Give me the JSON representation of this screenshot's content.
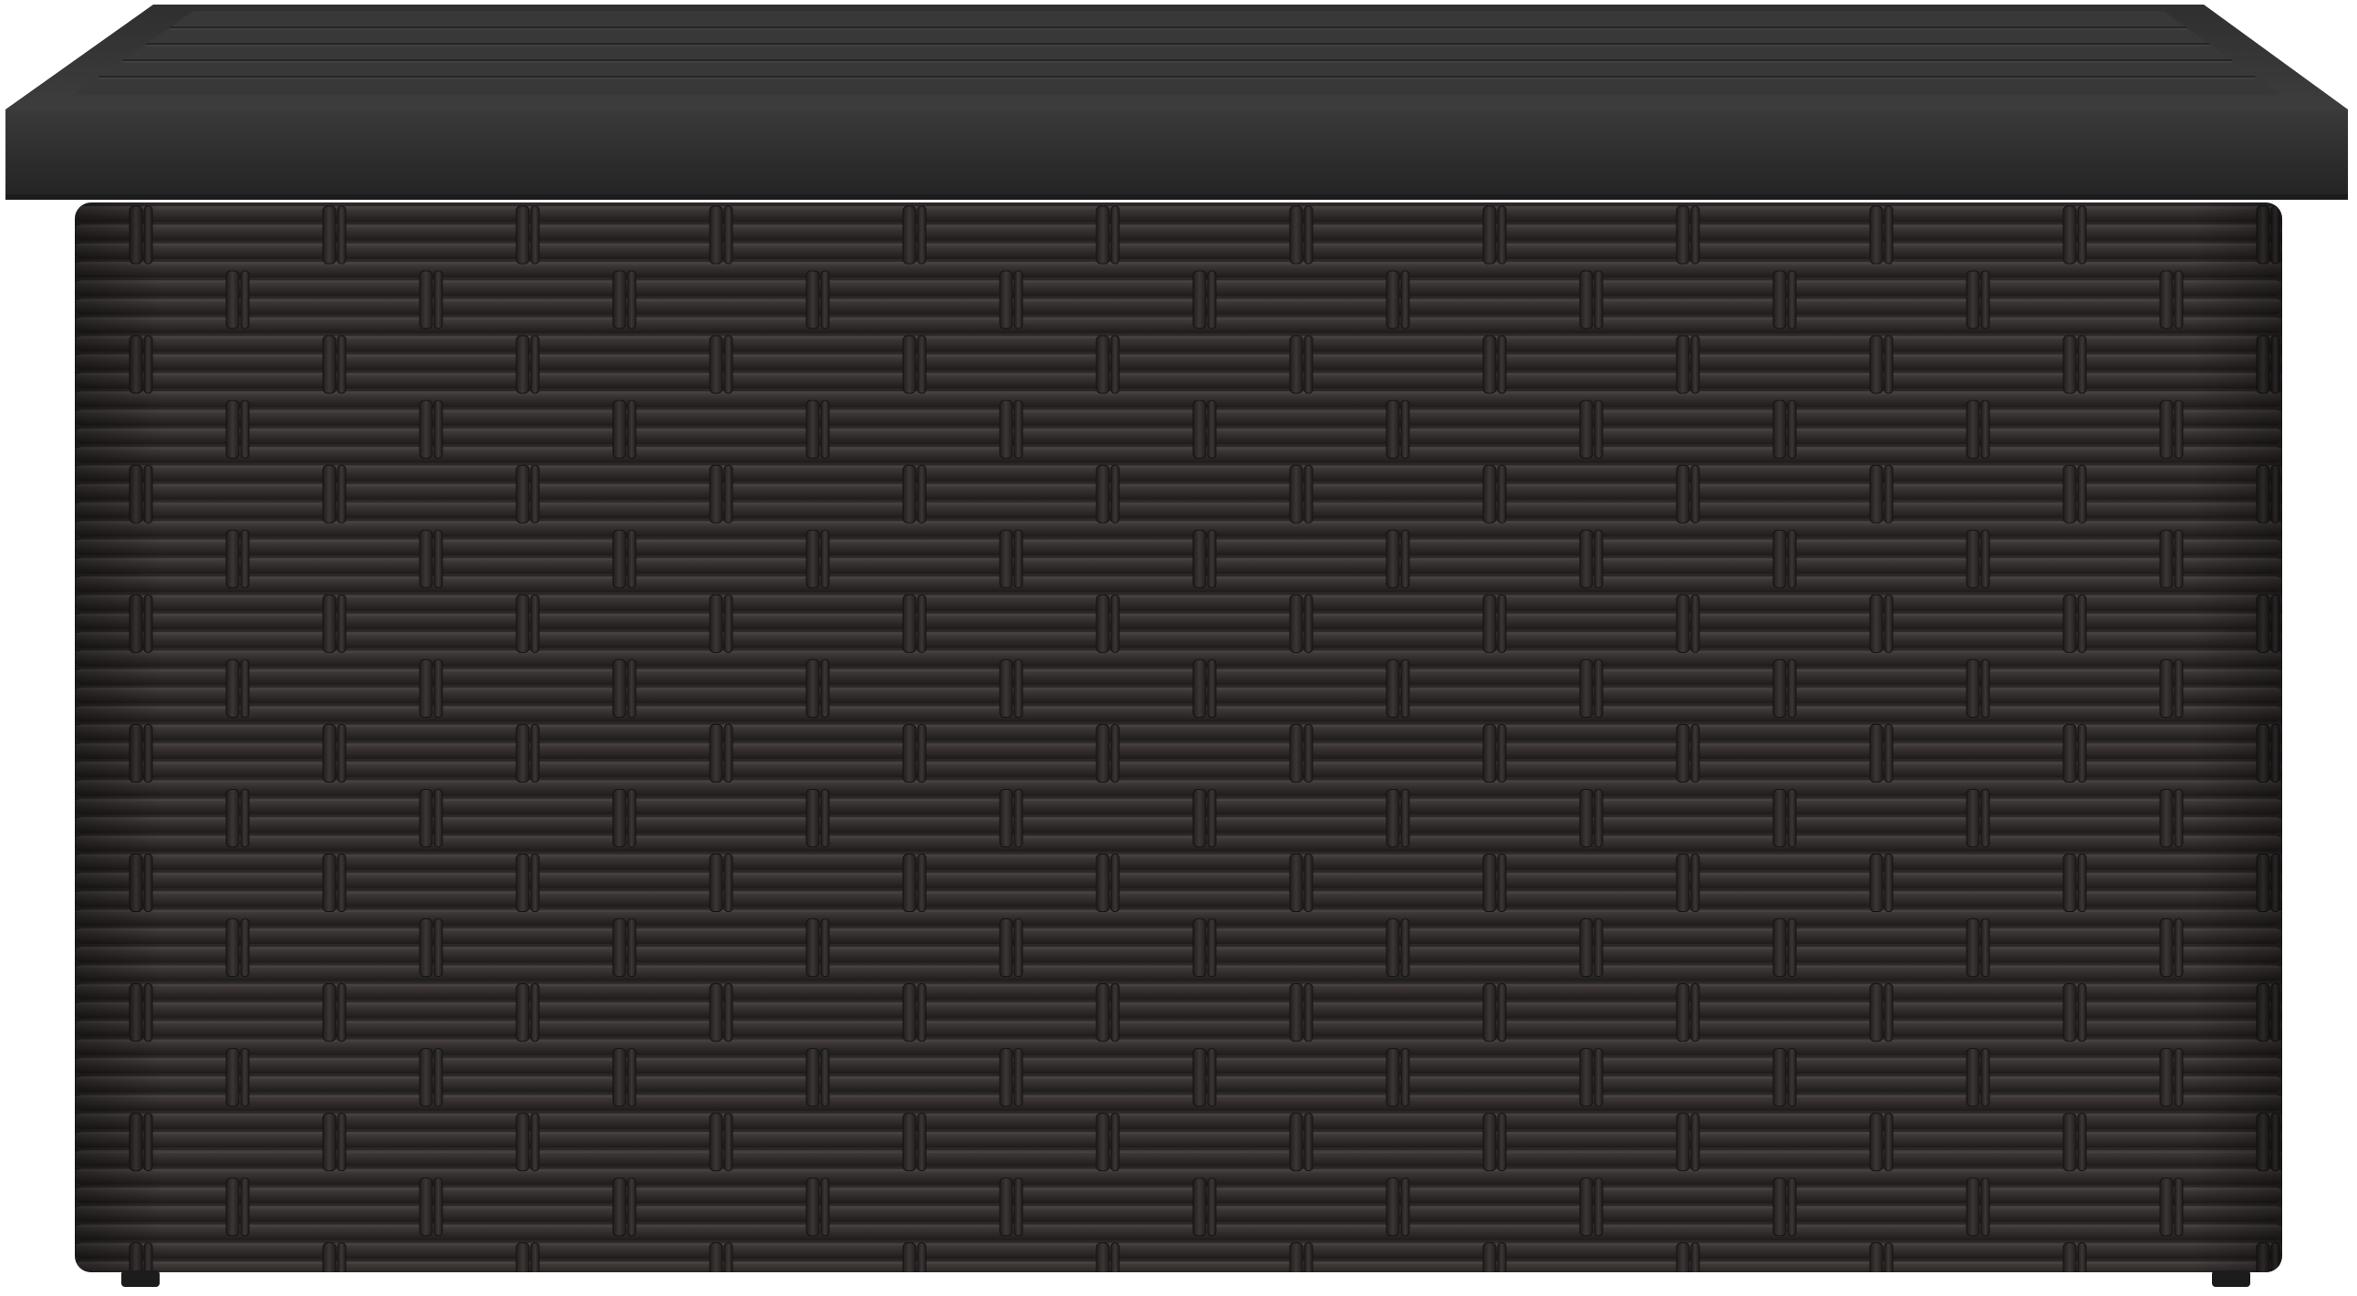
{
  "image": {
    "subject": "wicker-storage-box",
    "background": "#ffffff",
    "colors": {
      "lid_top": "#3a3a3a",
      "lid_edge": "#262626",
      "lid_groove": "#4a4a4a",
      "wicker_base": "#2d2a29",
      "wicker_strand": "#3a3534",
      "wicker_shadow": "#1a1817",
      "wicker_highlight": "#4a4443",
      "feet": "#1c1c1c"
    }
  }
}
